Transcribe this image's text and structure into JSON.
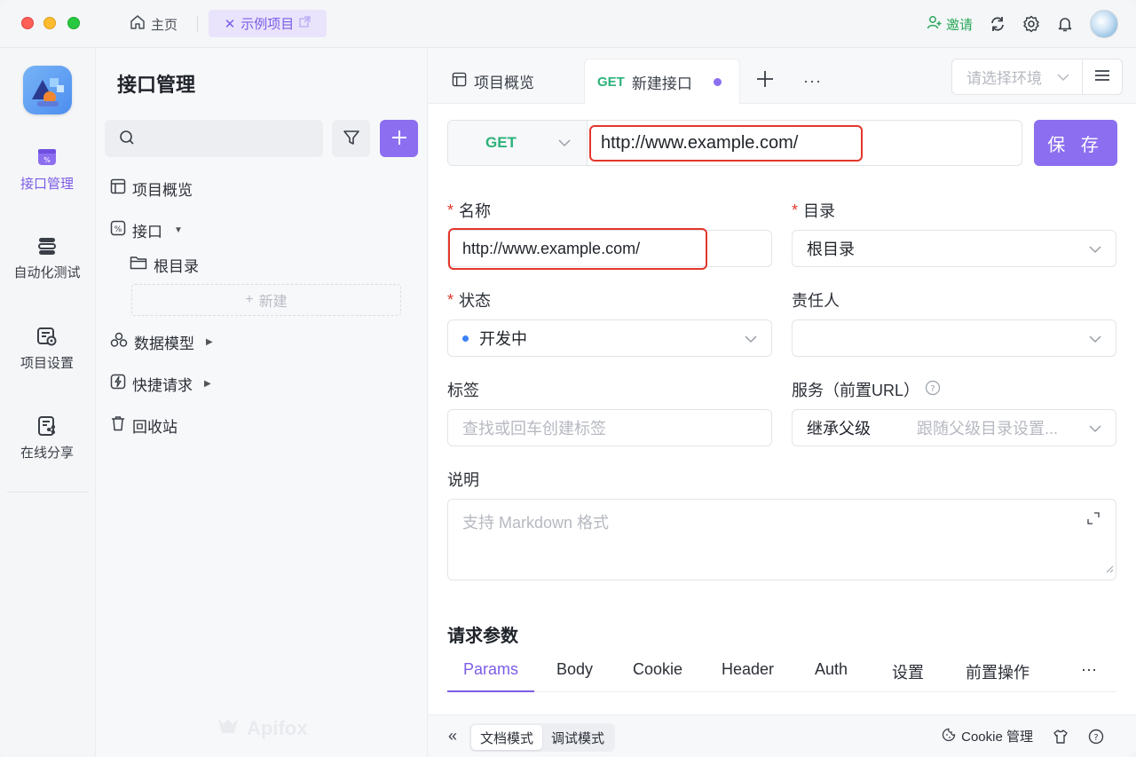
{
  "titlebar": {
    "home_label": "主页",
    "project_tab_label": "示例项目",
    "invite_label": "邀请"
  },
  "leftnav": {
    "items": [
      {
        "label": "接口管理",
        "icon": "api-manage-icon",
        "active": true
      },
      {
        "label": "自动化测试",
        "icon": "automation-icon",
        "active": false
      },
      {
        "label": "项目设置",
        "icon": "project-settings-icon",
        "active": false
      },
      {
        "label": "在线分享",
        "icon": "share-icon",
        "active": false
      }
    ]
  },
  "sidebar": {
    "title": "接口管理",
    "search_placeholder": "",
    "tree": {
      "overview": "项目概览",
      "api": "接口",
      "root_dir": "根目录",
      "new_label": "新建",
      "data_model": "数据模型",
      "quick_request": "快捷请求",
      "recycle": "回收站"
    },
    "watermark": "Apifox"
  },
  "main": {
    "tabs": {
      "overview": "项目概览",
      "api_method": "GET",
      "api_title": "新建接口"
    },
    "env_placeholder": "请选择环境",
    "request": {
      "method": "GET",
      "url": "http://www.example.com/",
      "save_label": "保 存"
    },
    "form": {
      "name_label": "名称",
      "name_value": "http://www.example.com/",
      "dir_label": "目录",
      "dir_value": "根目录",
      "status_label": "状态",
      "status_value": "开发中",
      "owner_label": "责任人",
      "owner_value": "",
      "tags_label": "标签",
      "tags_placeholder": "查找或回车创建标签",
      "service_label": "服务（前置URL）",
      "service_value": "继承父级",
      "service_hint": "跟随父级目录设置...",
      "desc_label": "说明",
      "desc_placeholder": "支持 Markdown 格式"
    },
    "params_section": {
      "title": "请求参数",
      "tabs": [
        "Params",
        "Body",
        "Cookie",
        "Header",
        "Auth",
        "设置",
        "前置操作",
        "···"
      ]
    }
  },
  "bottombar": {
    "doc_mode": "文档模式",
    "debug_mode": "调试模式",
    "cookie_label": "Cookie 管理"
  },
  "colors": {
    "accent": "#8c6ef0",
    "get_green": "#2db27a",
    "highlight_red": "#e3362c"
  }
}
